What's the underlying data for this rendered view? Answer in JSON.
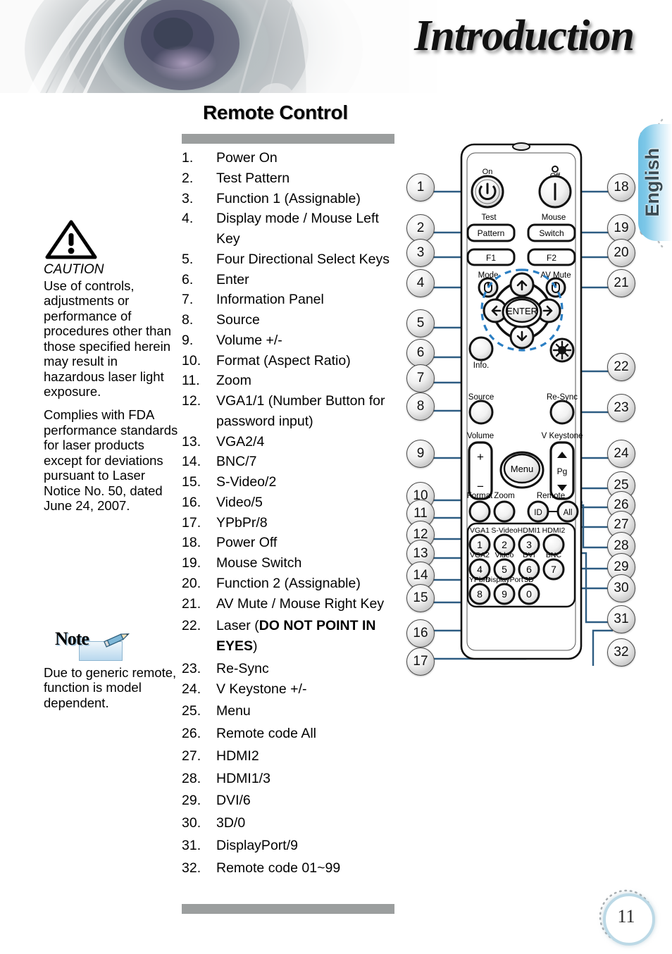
{
  "header": {
    "title": "Introduction",
    "decor_icon": "camera-lens-image"
  },
  "side_tab": {
    "label": "English"
  },
  "page": {
    "number": "11"
  },
  "section": {
    "title": "Remote Control"
  },
  "caution": {
    "icon": "warning-triangle-icon",
    "title": "CAUTION",
    "paragraph1": "Use of controls, adjustments or performance of procedures other than those specified herein may result in hazardous laser light exposure.",
    "paragraph2": "Complies with FDA performance standards for laser products except for deviations pursuant to Laser Notice No. 50, dated June 24, 2007."
  },
  "note": {
    "badge_label": "Note",
    "icon": "pencil-icon",
    "text": "Due to generic remote,  function is model dependent."
  },
  "remote_list": [
    {
      "num": "1.",
      "text": "Power On"
    },
    {
      "num": "2.",
      "text": "Test Pattern"
    },
    {
      "num": "3.",
      "text": "Function 1 (Assignable)"
    },
    {
      "num": "4.",
      "text": "Display mode / Mouse Left Key"
    },
    {
      "num": "5.",
      "text": "Four Directional Select Keys"
    },
    {
      "num": "6.",
      "text": "Enter"
    },
    {
      "num": "7.",
      "text": "Information Panel"
    },
    {
      "num": "8.",
      "text": "Source"
    },
    {
      "num": "9.",
      "text": "Volume +/-"
    },
    {
      "num": "10.",
      "text": "Format (Aspect Ratio)"
    },
    {
      "num": "11.",
      "text": "Zoom"
    },
    {
      "num": "12.",
      "text": "VGA1/1 (Number Button for password input)"
    },
    {
      "num": "13.",
      "text": "VGA2/4"
    },
    {
      "num": "14.",
      "text": "BNC/7"
    },
    {
      "num": "15.",
      "text": "S-Video/2"
    },
    {
      "num": "16.",
      "text": "Video/5"
    },
    {
      "num": "17.",
      "text": "YPbPr/8"
    },
    {
      "num": "18.",
      "text": "Power Off"
    },
    {
      "num": "19.",
      "text": "Mouse Switch"
    },
    {
      "num": "20.",
      "text": "Function 2 (Assignable)"
    },
    {
      "num": "21.",
      "text": "AV Mute / Mouse Right Key"
    },
    {
      "num": "22.",
      "text": "Laser (",
      "strong": "DO NOT POINT IN EYES",
      "tail": ")"
    },
    {
      "num": "23.",
      "text": "Re-Sync"
    },
    {
      "num": "24.",
      "text": "V Keystone +/-"
    },
    {
      "num": "25.",
      "text": "Menu"
    },
    {
      "num": "26.",
      "text": "Remote code All"
    },
    {
      "num": "27.",
      "text": "HDMI2"
    },
    {
      "num": "28.",
      "text": "HDMI1/3"
    },
    {
      "num": "29.",
      "text": "DVI/6"
    },
    {
      "num": "30.",
      "text": "3D/0"
    },
    {
      "num": "31.",
      "text": "DisplayPort/9"
    },
    {
      "num": "32.",
      "text": "Remote code 01~99"
    }
  ],
  "remote_diagram": {
    "button_labels": {
      "power_on": "On",
      "power_off": "Off",
      "test": "Test",
      "pattern": "Pattern",
      "mouse": "Mouse",
      "switch": "Switch",
      "f1": "F1",
      "f2": "F2",
      "mode": "Mode",
      "av_mute": "AV Mute",
      "enter": "ENTER",
      "info": "Info.",
      "source": "Source",
      "resync": "Re-Sync",
      "volume": "Volume",
      "volume_plus": "+",
      "volume_minus": "−",
      "v_keystone": "V Keystone",
      "pg": "Pg",
      "menu": "Menu",
      "format": "Format",
      "zoom": "Zoom",
      "remote": "Remote",
      "id": "ID",
      "all": "All"
    },
    "keypad": [
      {
        "label": "VGA1",
        "digit": "1"
      },
      {
        "label": "S-Video",
        "digit": "2"
      },
      {
        "label": "HDMI1",
        "digit": "3"
      },
      {
        "label": "HDMI2",
        "digit": ""
      },
      {
        "label": "VGA2",
        "digit": "4"
      },
      {
        "label": "Video",
        "digit": "5"
      },
      {
        "label": "DVI",
        "digit": "6"
      },
      {
        "label": "BNC",
        "digit": "7"
      },
      {
        "label": "YPbPr",
        "digit": "8"
      },
      {
        "label": "DisplayPort",
        "digit": "9"
      },
      {
        "label": "3D",
        "digit": "0"
      }
    ],
    "callouts_left": [
      "1",
      "2",
      "3",
      "4",
      "5",
      "6",
      "7",
      "8",
      "9",
      "10",
      "11",
      "12",
      "13",
      "14",
      "15",
      "16",
      "17"
    ],
    "callouts_right": [
      "18",
      "19",
      "20",
      "21",
      "22",
      "23",
      "24",
      "25",
      "26",
      "27",
      "28",
      "29",
      "30",
      "31",
      "32"
    ]
  },
  "colors": {
    "rule_gray": "#9b9e9e",
    "tab_blue": "#7ec8e8",
    "callout_line": "#2d5c82",
    "highlight_dash": "#2b7fc4"
  }
}
